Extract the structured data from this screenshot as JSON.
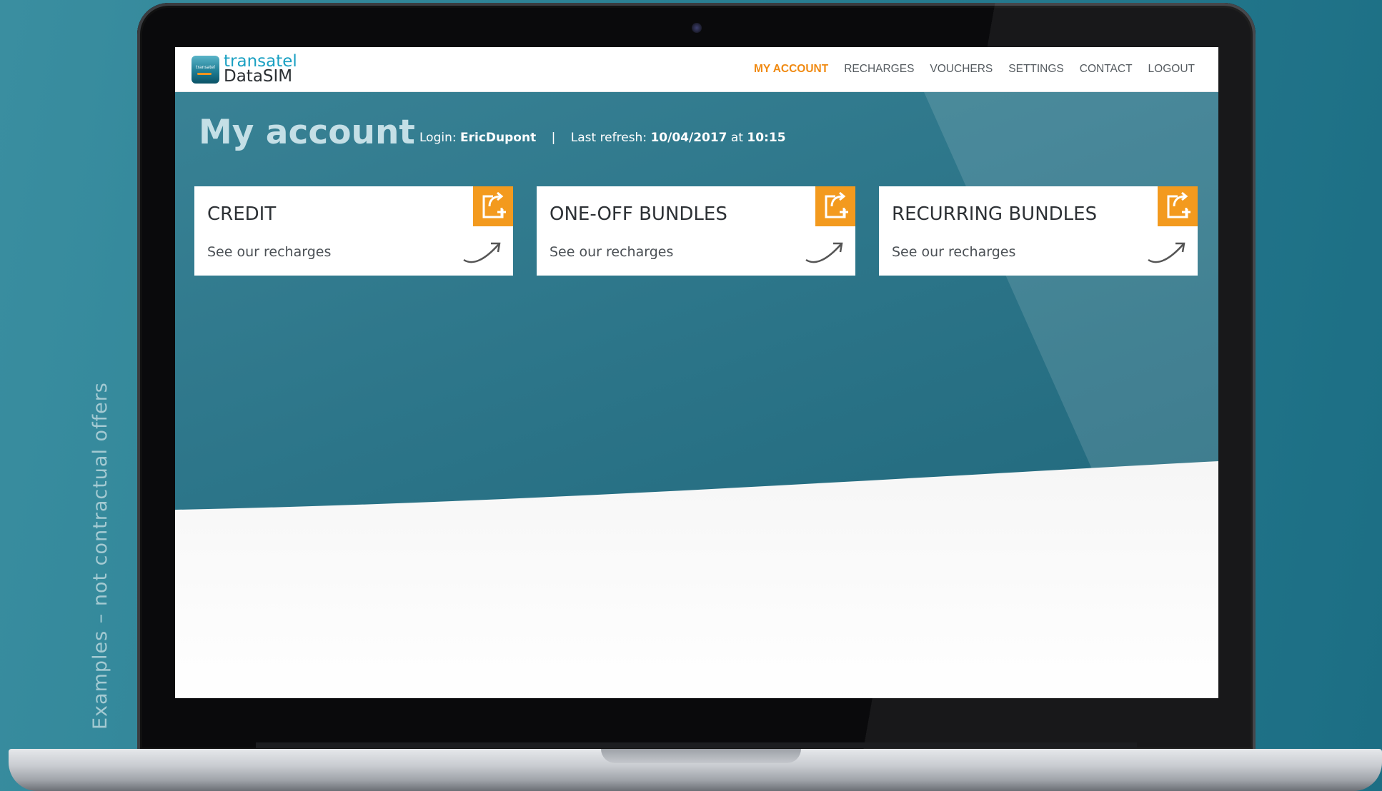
{
  "disclaimer": "Examples – not contractual offers",
  "logo": {
    "mark_text": "transatel",
    "brand": "transatel",
    "product": "DataSIM"
  },
  "nav": {
    "items": [
      {
        "label": "MY ACCOUNT",
        "active": true
      },
      {
        "label": "RECHARGES",
        "active": false
      },
      {
        "label": "VOUCHERS",
        "active": false
      },
      {
        "label": "SETTINGS",
        "active": false
      },
      {
        "label": "CONTACT",
        "active": false
      },
      {
        "label": "LOGOUT",
        "active": false
      }
    ]
  },
  "page": {
    "title": "My account",
    "login_label": "Login:",
    "login_value": "EricDupont",
    "separator": "|",
    "refresh_label": "Last refresh:",
    "refresh_date": "10/04/2017",
    "refresh_at": "at",
    "refresh_time": "10:15"
  },
  "cards": [
    {
      "title": "CREDIT",
      "link": "See our recharges",
      "icon": "add-recharge-icon"
    },
    {
      "title": "ONE-OFF BUNDLES",
      "link": "See our recharges",
      "icon": "add-recharge-icon"
    },
    {
      "title": "RECURRING BUNDLES",
      "link": "See our recharges",
      "icon": "add-recharge-icon"
    }
  ],
  "colors": {
    "accent": "#f39a1e",
    "active_nav": "#f08a12",
    "background_teal": "#2c7589",
    "logo_blue": "#1aa0c2"
  }
}
